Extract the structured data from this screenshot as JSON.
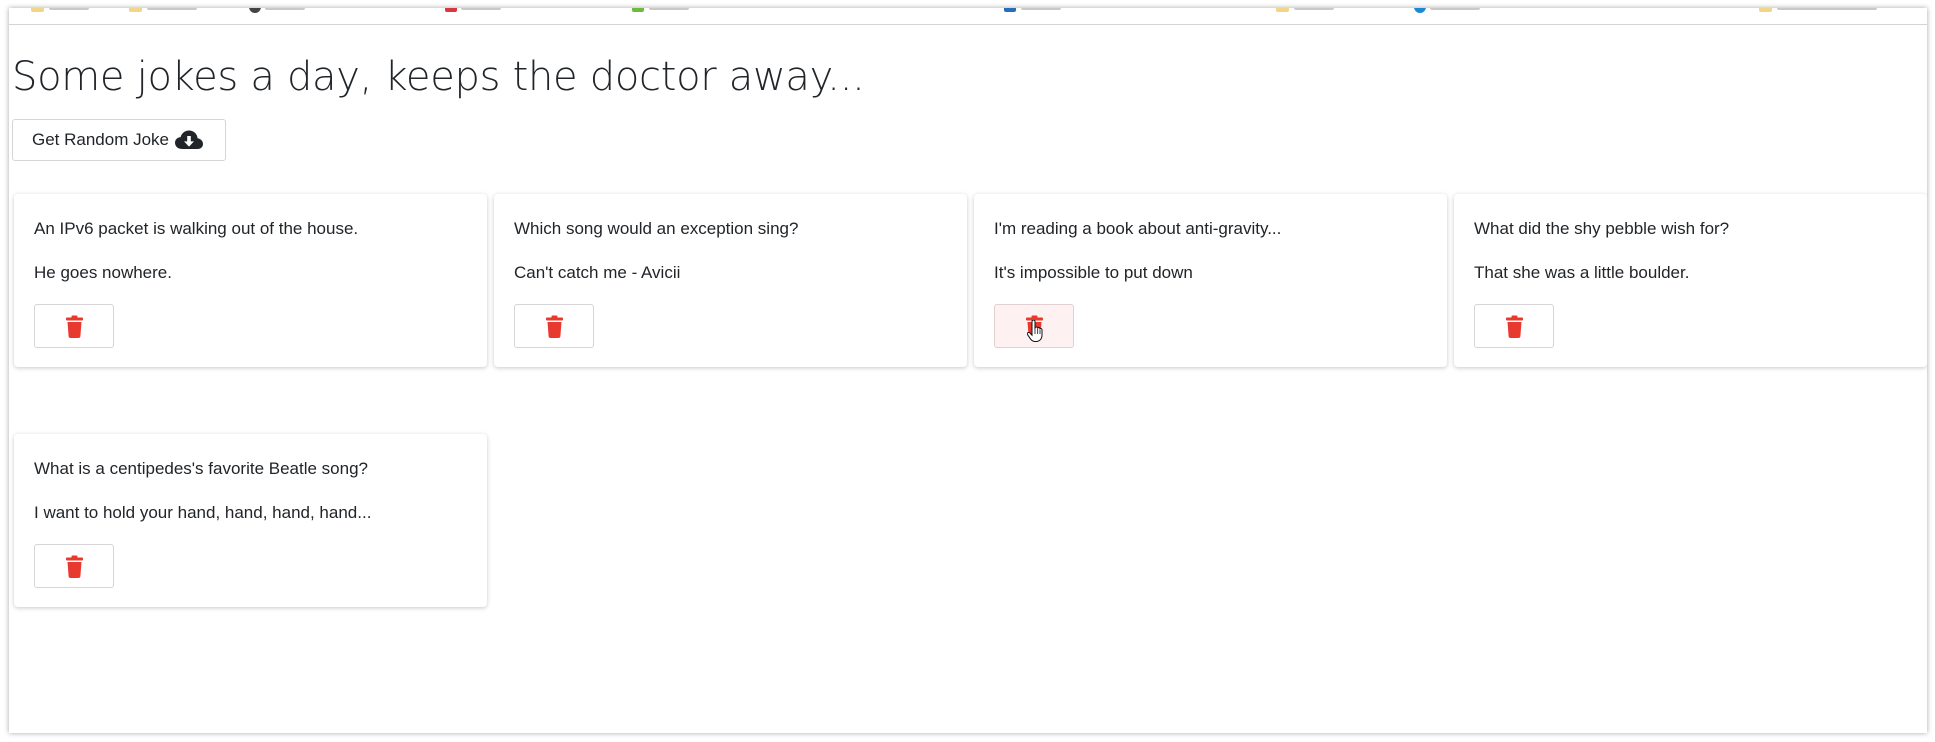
{
  "page": {
    "title": "Some jokes a day, keeps the doctor away...",
    "get_joke_label": "Get Random Joke"
  },
  "icons": {
    "download": "cloud-download-icon",
    "delete": "trash-icon",
    "cursor": "hand-pointer-cursor"
  },
  "colors": {
    "delete_accent": "#e8392f",
    "text": "#212529",
    "hover_bg": "#fdf1f1"
  },
  "jokes": [
    {
      "setup": "An IPv6 packet is walking out of the house.",
      "punchline": "He goes nowhere."
    },
    {
      "setup": "Which song would an exception sing?",
      "punchline": "Can't catch me - Avicii"
    },
    {
      "setup": "I'm reading a book about anti-gravity...",
      "punchline": "It's impossible to put down"
    },
    {
      "setup": "What did the shy pebble wish for?",
      "punchline": "That she was a little boulder."
    },
    {
      "setup": "What is a centipedes's favorite Beatle song?",
      "punchline": "I want to hold your hand, hand, hand, hand..."
    }
  ]
}
